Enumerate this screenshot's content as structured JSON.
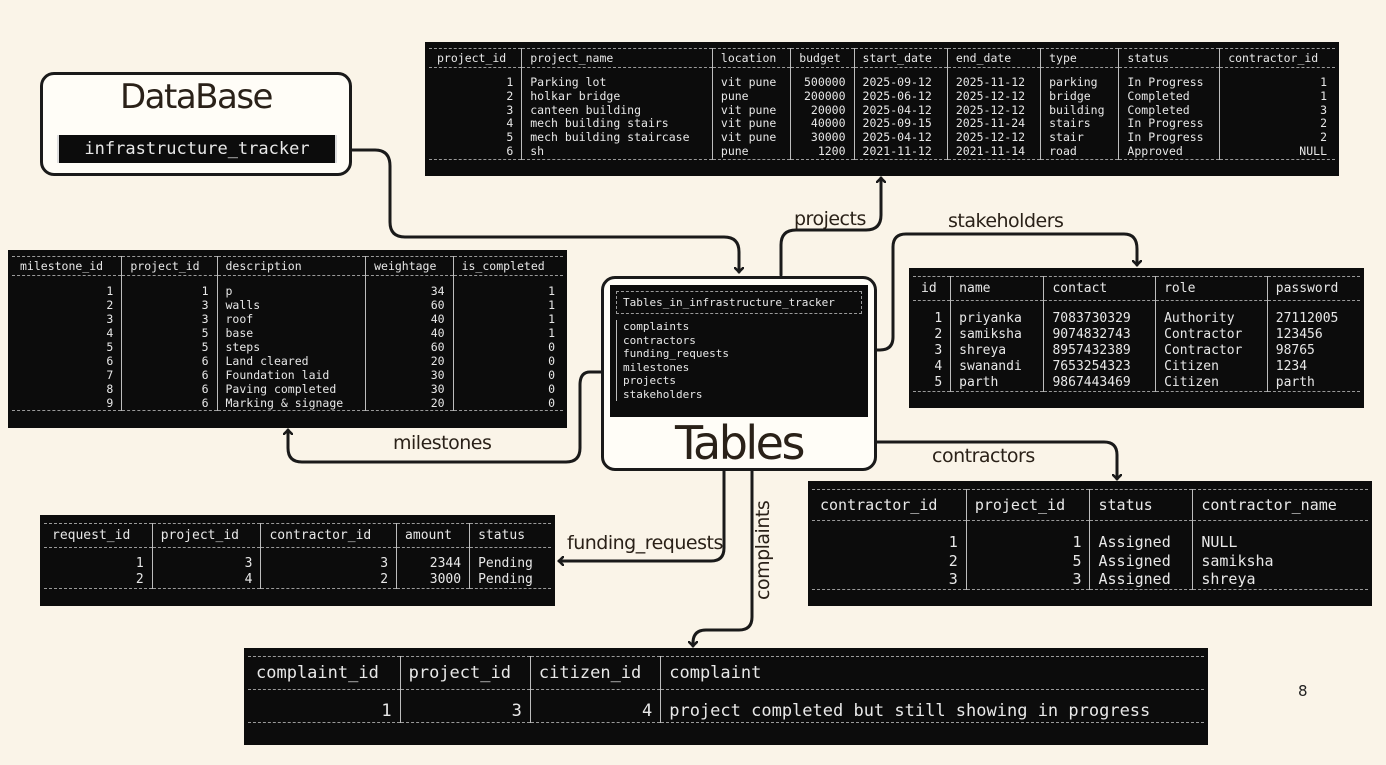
{
  "database": {
    "title": "DataBase",
    "name": "infrastructure_tracker"
  },
  "tables_box": {
    "title": "Tables",
    "header": "Tables_in_infrastructure_tracker",
    "items": [
      "complaints",
      "contractors",
      "funding_requests",
      "milestones",
      "projects",
      "stakeholders"
    ]
  },
  "labels": {
    "projects": "projects",
    "stakeholders": "stakeholders",
    "milestones": "milestones",
    "contractors": "contractors",
    "funding_requests": "funding_requests",
    "complaints": "complaints"
  },
  "projects_table": {
    "columns": [
      "project_id",
      "project_name",
      "location",
      "budget",
      "start_date",
      "end_date",
      "type",
      "status",
      "contractor_id"
    ],
    "rows": [
      [
        "1",
        "Parking lot",
        "vit pune",
        "500000",
        "2025-09-12",
        "2025-11-12",
        "parking",
        "In Progress",
        "1"
      ],
      [
        "2",
        "holkar bridge",
        "pune",
        "200000",
        "2025-06-12",
        "2025-12-12",
        "bridge",
        "Completed",
        "1"
      ],
      [
        "3",
        "canteen building",
        "vit pune",
        "20000",
        "2025-04-12",
        "2025-12-12",
        "building",
        "Completed",
        "3"
      ],
      [
        "4",
        "mech building stairs",
        "vit pune",
        "40000",
        "2025-09-15",
        "2025-11-24",
        "stairs",
        "In Progress",
        "2"
      ],
      [
        "5",
        "mech building staircase",
        "vit pune",
        "30000",
        "2025-04-12",
        "2025-12-12",
        "stair",
        "In Progress",
        "2"
      ],
      [
        "6",
        "sh",
        "pune",
        "1200",
        "2021-11-12",
        "2021-11-14",
        "road",
        "Approved",
        "NULL"
      ]
    ]
  },
  "milestones_table": {
    "columns": [
      "milestone_id",
      "project_id",
      "description",
      "weightage",
      "is_completed"
    ],
    "rows": [
      [
        "1",
        "1",
        "p",
        "34",
        "1"
      ],
      [
        "2",
        "3",
        "walls",
        "60",
        "1"
      ],
      [
        "3",
        "3",
        "roof",
        "40",
        "1"
      ],
      [
        "4",
        "5",
        "base",
        "40",
        "1"
      ],
      [
        "5",
        "5",
        "steps",
        "60",
        "0"
      ],
      [
        "6",
        "6",
        "Land cleared",
        "20",
        "0"
      ],
      [
        "7",
        "6",
        "Foundation laid",
        "30",
        "0"
      ],
      [
        "8",
        "6",
        "Paving completed",
        "30",
        "0"
      ],
      [
        "9",
        "6",
        "Marking & signage",
        "20",
        "0"
      ]
    ]
  },
  "stakeholders_table": {
    "columns": [
      "id",
      "name",
      "contact",
      "role",
      "password"
    ],
    "rows": [
      [
        "1",
        "priyanka",
        "7083730329",
        "Authority",
        "27112005"
      ],
      [
        "2",
        "samiksha",
        "9074832743",
        "Contractor",
        "123456"
      ],
      [
        "3",
        "shreya",
        "8957432389",
        "Contractor",
        "98765"
      ],
      [
        "4",
        "swanandi",
        "7653254323",
        "Citizen",
        "1234"
      ],
      [
        "5",
        "parth",
        "9867443469",
        "Citizen",
        "parth"
      ]
    ]
  },
  "contractors_table": {
    "columns": [
      "contractor_id",
      "project_id",
      "status",
      "contractor_name"
    ],
    "rows": [
      [
        "1",
        "1",
        "Assigned",
        "NULL"
      ],
      [
        "2",
        "5",
        "Assigned",
        "samiksha"
      ],
      [
        "3",
        "3",
        "Assigned",
        "shreya"
      ]
    ]
  },
  "funding_table": {
    "columns": [
      "request_id",
      "project_id",
      "contractor_id",
      "amount",
      "status"
    ],
    "rows": [
      [
        "1",
        "3",
        "3",
        "2344",
        "Pending"
      ],
      [
        "2",
        "4",
        "2",
        "3000",
        "Pending"
      ]
    ]
  },
  "complaints_table": {
    "columns": [
      "complaint_id",
      "project_id",
      "citizen_id",
      "complaint"
    ],
    "rows": [
      [
        "1",
        "3",
        "4",
        "project completed but still showing in progress"
      ]
    ]
  },
  "page_number": "8"
}
